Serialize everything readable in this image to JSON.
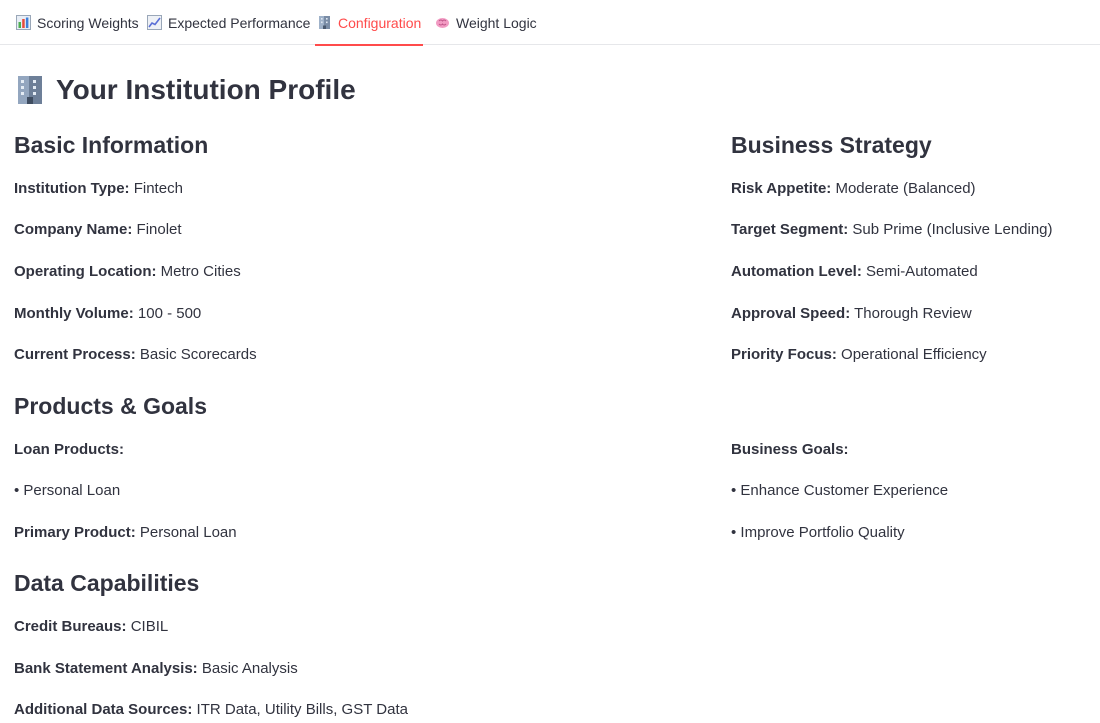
{
  "tabs": [
    {
      "label": "Scoring Weights",
      "icon": "bar-chart-icon",
      "active": false
    },
    {
      "label": "Expected Performance",
      "icon": "line-chart-icon",
      "active": false
    },
    {
      "label": "Configuration",
      "icon": "building-icon",
      "active": true
    },
    {
      "label": "Weight Logic",
      "icon": "brain-icon",
      "active": false
    }
  ],
  "page": {
    "title": "Your Institution Profile",
    "title_icon": "building-icon"
  },
  "basic_info": {
    "heading": "Basic Information",
    "institution_type": {
      "label": "Institution Type:",
      "value": "Fintech"
    },
    "company_name": {
      "label": "Company Name:",
      "value": "Finolet"
    },
    "operating_location": {
      "label": "Operating Location:",
      "value": "Metro Cities"
    },
    "monthly_volume": {
      "label": "Monthly Volume:",
      "value": "100 - 500"
    },
    "current_process": {
      "label": "Current Process:",
      "value": "Basic Scorecards"
    }
  },
  "business_strategy": {
    "heading": "Business Strategy",
    "risk_appetite": {
      "label": "Risk Appetite:",
      "value": "Moderate (Balanced)"
    },
    "target_segment": {
      "label": "Target Segment:",
      "value": "Sub Prime (Inclusive Lending)"
    },
    "automation_level": {
      "label": "Automation Level:",
      "value": "Semi-Automated"
    },
    "approval_speed": {
      "label": "Approval Speed:",
      "value": "Thorough Review"
    },
    "priority_focus": {
      "label": "Priority Focus:",
      "value": "Operational Efficiency"
    }
  },
  "products_goals": {
    "heading": "Products & Goals",
    "loan_products_label": "Loan Products:",
    "loan_products": [
      "• Personal Loan"
    ],
    "primary_product": {
      "label": "Primary Product:",
      "value": "Personal Loan"
    },
    "business_goals_label": "Business Goals:",
    "business_goals": [
      "• Enhance Customer Experience",
      "• Improve Portfolio Quality"
    ]
  },
  "data_capabilities": {
    "heading": "Data Capabilities",
    "credit_bureaus": {
      "label": "Credit Bureaus:",
      "value": "CIBIL"
    },
    "bank_statement": {
      "label": "Bank Statement Analysis:",
      "value": "Basic Analysis"
    },
    "additional_sources": {
      "label": "Additional Data Sources:",
      "value": "ITR Data, Utility Bills, GST Data"
    }
  }
}
